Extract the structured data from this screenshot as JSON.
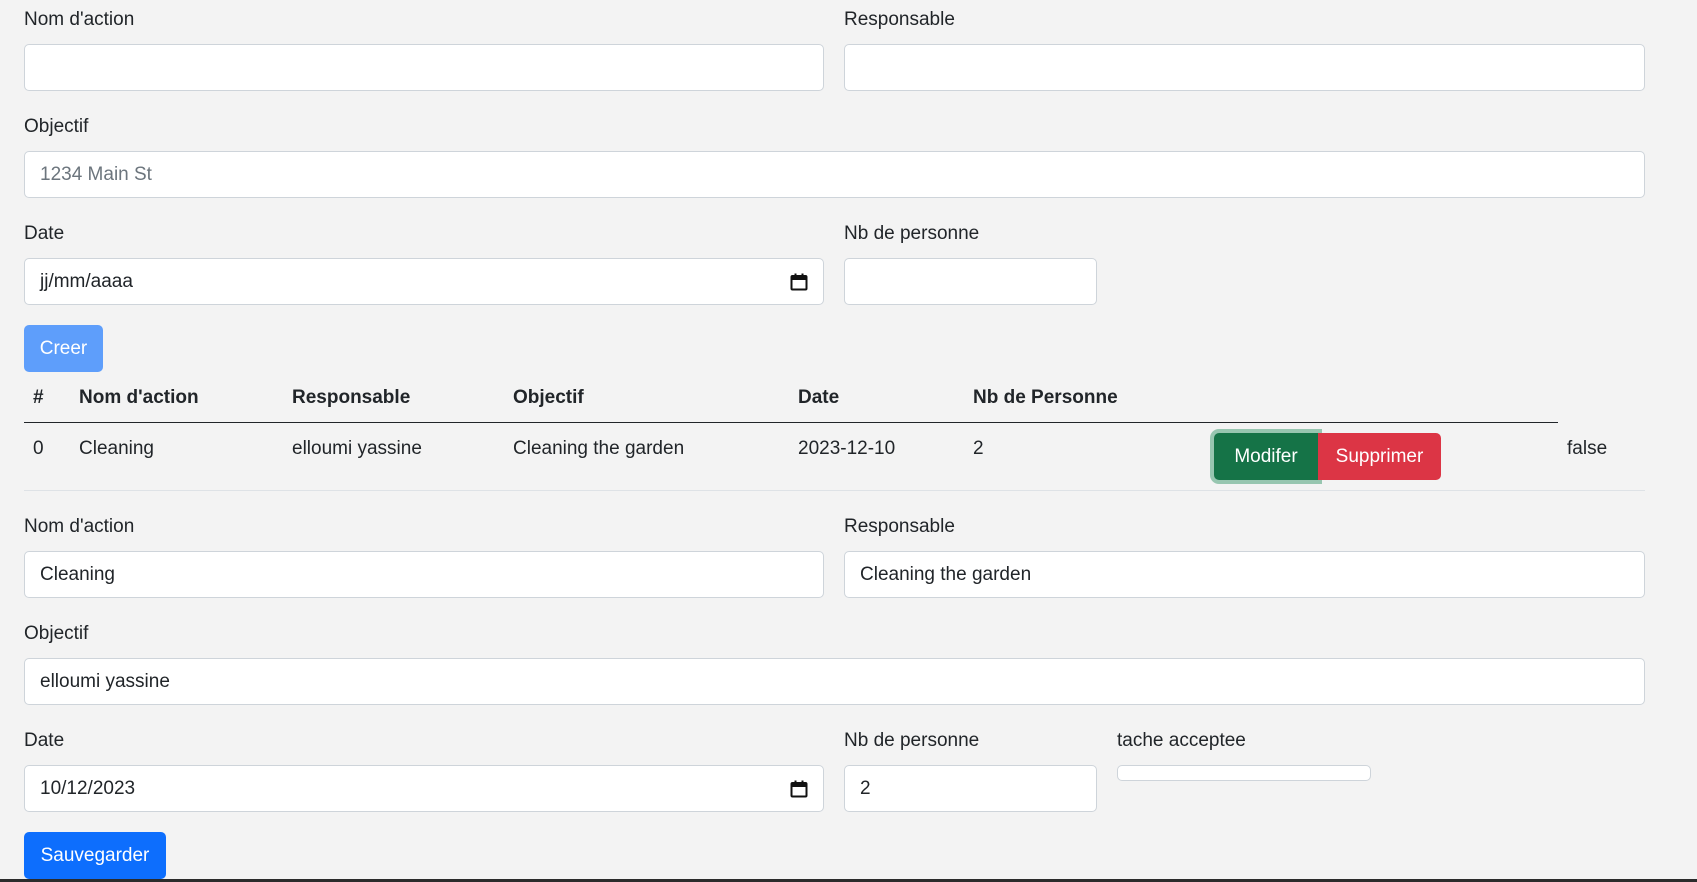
{
  "create_form": {
    "nom_label": "Nom d'action",
    "nom_value": "",
    "responsable_label": "Responsable",
    "responsable_value": "",
    "objectif_label": "Objectif",
    "objectif_placeholder": "1234 Main St",
    "date_label": "Date",
    "date_value": "jj/mm/aaaa",
    "nb_label": "Nb de personne",
    "nb_value": "",
    "submit_label": "Creer"
  },
  "table": {
    "headers": [
      "#",
      "Nom d'action",
      "Responsable",
      "Objectif",
      "Date",
      "Nb de Personne"
    ],
    "rows": [
      {
        "index": "0",
        "nom": "Cleaning",
        "responsable": "elloumi yassine",
        "objectif": "Cleaning the garden",
        "date": "2023-12-10",
        "nb": "2",
        "status": "false"
      }
    ],
    "edit_label": "Modifer",
    "delete_label": "Supprimer"
  },
  "edit_form": {
    "nom_label": "Nom d'action",
    "nom_value": "Cleaning",
    "responsable_label": "Responsable",
    "responsable_value": "Cleaning the garden",
    "objectif_label": "Objectif",
    "objectif_value": "elloumi yassine",
    "date_label": "Date",
    "date_value": "10/12/2023",
    "nb_label": "Nb de personne",
    "nb_value": "2",
    "accepted_label": "tache acceptee",
    "accepted_value": "",
    "submit_label": "Sauvegarder"
  },
  "icons": {
    "date_picker": "calendar-icon"
  },
  "colors": {
    "background": "#f3f3f3",
    "primary_disabled": "#5e9efb",
    "primary": "#0d6efd",
    "success": "#157347",
    "danger": "#dc3545"
  }
}
